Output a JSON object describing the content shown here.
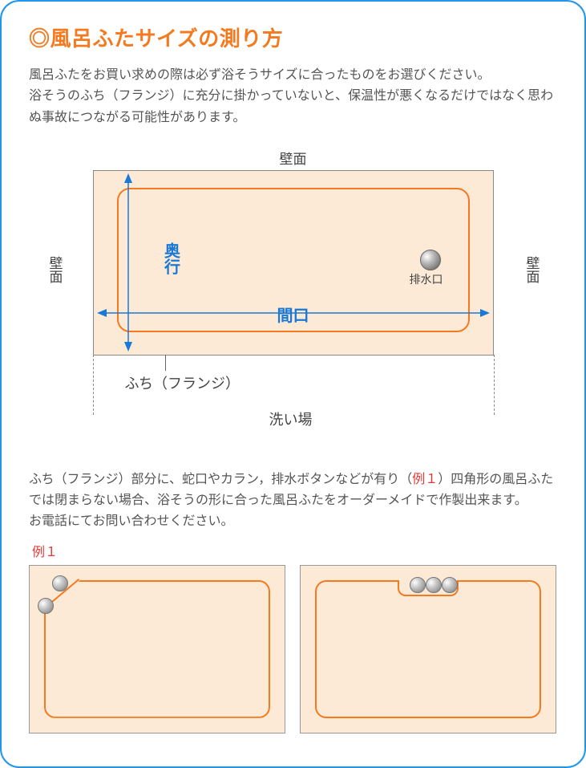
{
  "title": "◎風呂ふたサイズの測り方",
  "lead": "風呂ふたをお買い求めの際は必ず浴そうサイズに合ったものをお選びください。\n浴そうのふち（フランジ）に充分に掛かっていないと、保温性が悪くなるだけではなく思わぬ事故につながる可能性があります。",
  "figure": {
    "wall": "壁面",
    "depth_label": "奥行",
    "width_label": "間口",
    "drain_label": "排水口",
    "flange_label": "ふち（フランジ）",
    "wash_label": "洗い場"
  },
  "body_pre": "ふち（フランジ）部分に、蛇口やカラン，排水ボタンなどが有り（",
  "body_ex": "例１",
  "body_post": "）四角形の風呂ふたでは閉まらない場合、浴そうの形に合った風呂ふたをオーダーメイドで作製出来ます。\nお電話にてお問い合わせください。",
  "example_label": "例１"
}
